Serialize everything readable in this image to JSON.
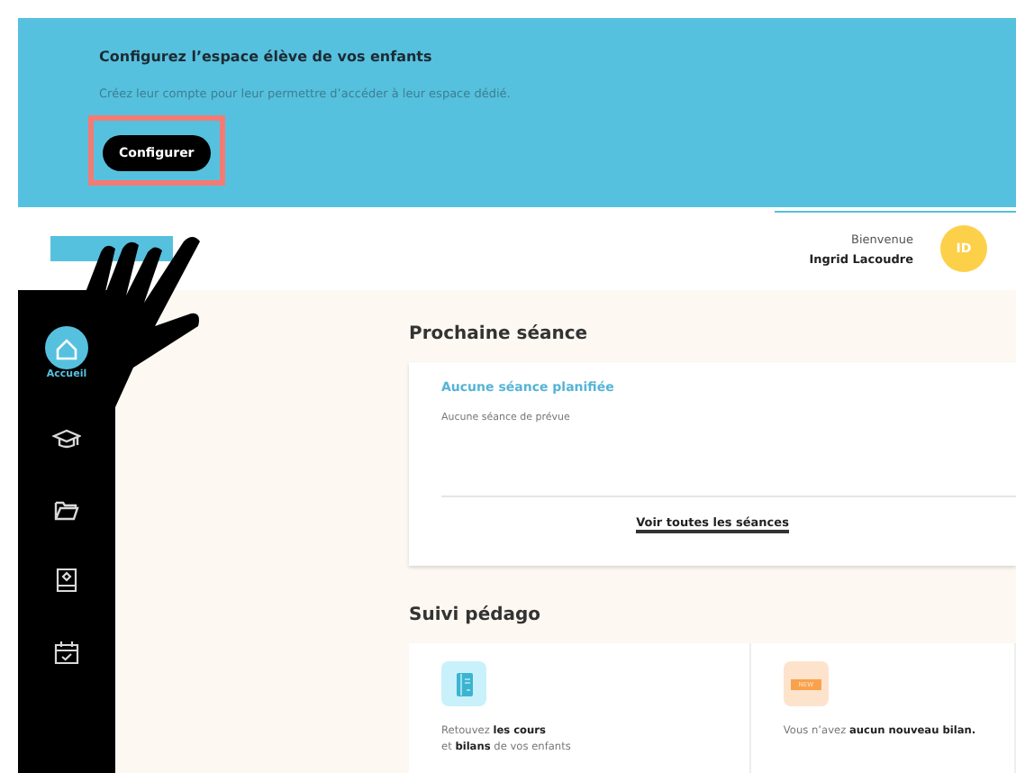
{
  "banner": {
    "title": "Configurez l’espace élève de vos enfants",
    "text": "Créez leur compte pour leur permettre d’accéder à leur espace dédié.",
    "button": "Configurer",
    "highlighted": true
  },
  "header": {
    "greeting": "Bienvenue",
    "user_name": "Ingrid Lacoudre",
    "avatar_initials": "ID"
  },
  "sidebar": {
    "items": [
      {
        "kind": "home",
        "label": "Accueil",
        "selected": true
      },
      {
        "kind": "courses",
        "selected": false
      },
      {
        "kind": "folder",
        "selected": false
      },
      {
        "kind": "certificate",
        "selected": false
      },
      {
        "kind": "calendar",
        "selected": false
      }
    ]
  },
  "next_session": {
    "heading": "Prochaine séance",
    "status": "Aucune séance planifiée",
    "detail": "Aucune séance de prévue",
    "link": "Voir toutes les séances"
  },
  "follow_up": {
    "heading": "Suivi pédago",
    "cards": [
      {
        "kind": "courses",
        "text": "Retouvez **les cours**",
        "text_2": "et **bilans** de vos enfants"
      },
      {
        "kind": "reports",
        "badge": "NEW",
        "text": "Vous n’avez **aucun nouveau bilan.**"
      }
    ]
  }
}
